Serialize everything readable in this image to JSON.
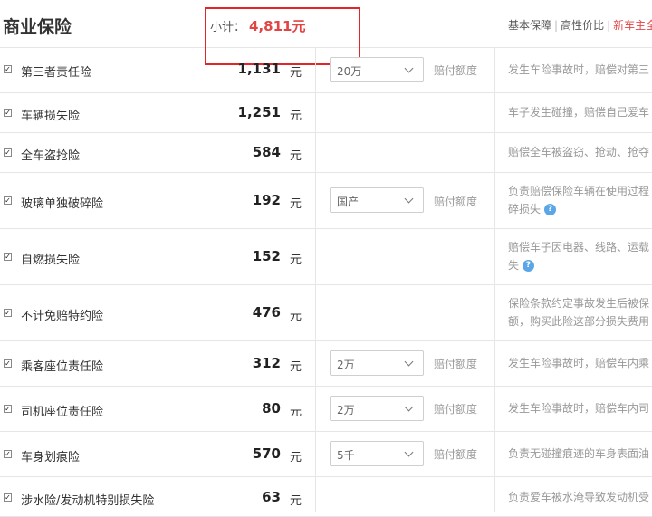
{
  "header": {
    "title": "商业保险",
    "subtotal_label": "小计：",
    "subtotal_value": "4,811元",
    "filter_basic": "基本保障",
    "filter_value": "高性价比",
    "filter_new": "新车主全"
  },
  "unit": "元",
  "claim_label": "赔付额度",
  "rows": [
    {
      "name": "第三者责任险",
      "price": "1,131",
      "select": "20万",
      "desc1": "发生车险事故时，赔偿对第三"
    },
    {
      "name": "车辆损失险",
      "price": "1,251",
      "desc1": "车子发生碰撞，赔偿自己爱车"
    },
    {
      "name": "全车盗抢险",
      "price": "584",
      "desc1": "赔偿全车被盗窃、抢劫、抢夺"
    },
    {
      "name": "玻璃单独破碎险",
      "price": "192",
      "select": "国产",
      "desc1": "负责赔偿保险车辆在使用过程",
      "desc2": "碎损失"
    },
    {
      "name": "自燃损失险",
      "price": "152",
      "desc1": "赔偿车子因电器、线路、运载",
      "desc2": "失"
    },
    {
      "name": "不计免赔特约险",
      "price": "476",
      "desc1": "保险条款约定事故发生后被保",
      "desc2": "额，购买此险这部分损失费用"
    },
    {
      "name": "乘客座位责任险",
      "price": "312",
      "select": "2万",
      "desc1": "发生车险事故时，赔偿车内乘"
    },
    {
      "name": "司机座位责任险",
      "price": "80",
      "select": "2万",
      "desc1": "发生车险事故时，赔偿车内司"
    },
    {
      "name": "车身划痕险",
      "price": "570",
      "select": "5千",
      "desc1": "负责无碰撞痕迹的车身表面油"
    },
    {
      "name": "涉水险/发动机特别损失险",
      "price": "63",
      "desc1": "负责爱车被水淹导致发动机受"
    }
  ],
  "icons": {
    "check": "checkbox-checked-icon",
    "chevron": "chevron-down-icon",
    "help": "question-help-icon"
  }
}
